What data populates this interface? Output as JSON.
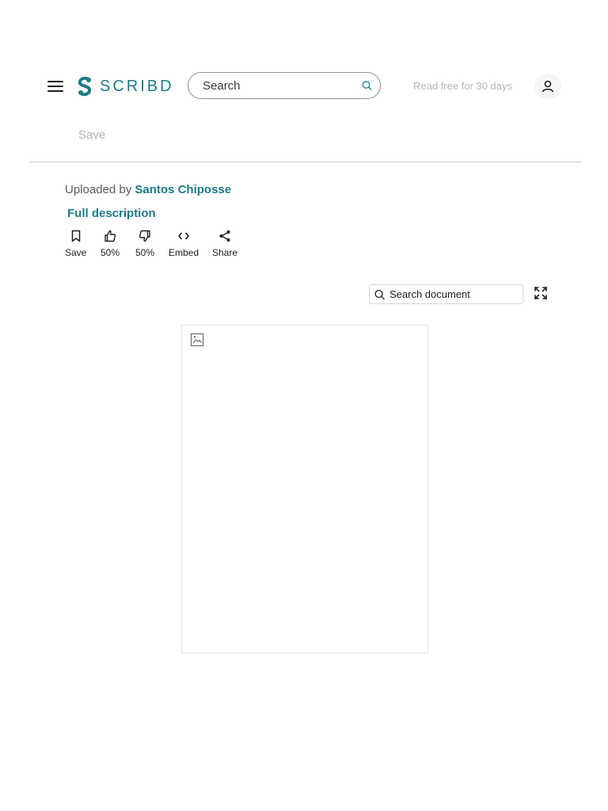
{
  "header": {
    "logo_text": "SCRIBD",
    "search": {
      "placeholder": "Search",
      "value": ""
    },
    "cta": "Read free for 30 days",
    "save_label": "Save"
  },
  "document": {
    "uploaded_prefix": "Uploaded by",
    "author": "Santos Chiposse",
    "full_description": "Full description",
    "actions": [
      {
        "label": "Save",
        "icon": "bookmark-icon"
      },
      {
        "label": "50%",
        "icon": "thumbs-up-icon"
      },
      {
        "label": "50%",
        "icon": "thumbs-down-icon"
      },
      {
        "label": "Embed",
        "icon": "code-icon"
      },
      {
        "label": "Share",
        "icon": "share-icon"
      }
    ],
    "doc_search": {
      "placeholder": "Search document",
      "value": ""
    }
  },
  "colors": {
    "brand": "#1e7b85",
    "muted": "#b0b0b0",
    "text": "#1e1e1e"
  }
}
